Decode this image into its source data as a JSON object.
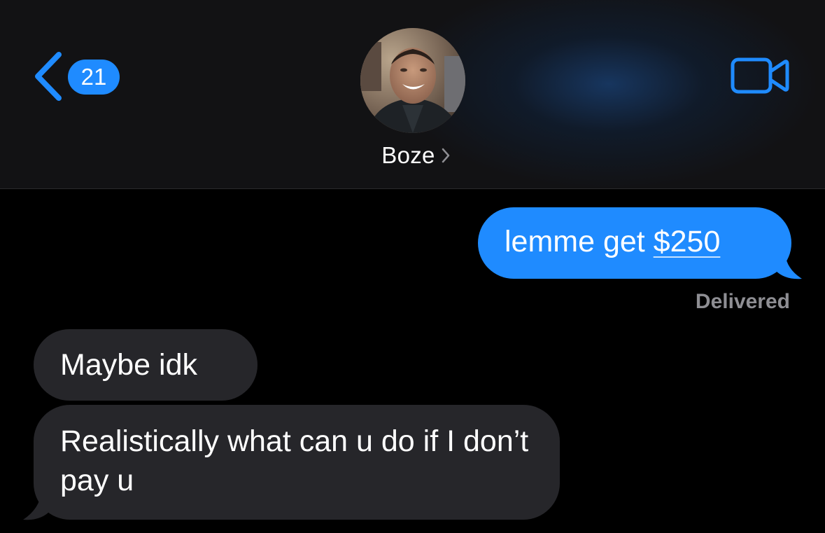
{
  "header": {
    "unread_count": "21",
    "contact_name": "Boze",
    "icons": {
      "back": "chevron-left-icon",
      "name_disclosure": "chevron-right-icon",
      "video_call": "video-camera-icon"
    }
  },
  "messages": [
    {
      "direction": "outgoing",
      "text_before_link": "lemme get ",
      "link_text": "$250",
      "status": "Delivered"
    },
    {
      "direction": "incoming",
      "text": "Maybe idk"
    },
    {
      "direction": "incoming",
      "text": "Realistically what can u do if I don’t pay u"
    }
  ],
  "colors": {
    "accent": "#1f8bff",
    "outgoing_bubble": "#1f8bff",
    "incoming_bubble": "#26262a",
    "header_bg": "#121214",
    "status_text": "#8e8e93",
    "background": "#000000"
  }
}
